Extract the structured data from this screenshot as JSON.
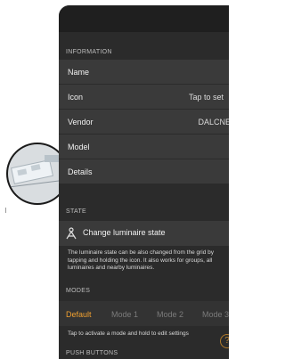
{
  "sections": {
    "information": "INFORMATION",
    "state": "STATE",
    "modes": "MODES",
    "push_buttons": "PUSH BUTTONS"
  },
  "info_rows": [
    {
      "label": "Name",
      "value": ""
    },
    {
      "label": "Icon",
      "value": "Tap to set"
    },
    {
      "label": "Vendor",
      "value": "DALCNE"
    },
    {
      "label": "Model",
      "value": ""
    },
    {
      "label": "Details",
      "value": ""
    }
  ],
  "state": {
    "button_label": "Change luminaire state",
    "note": "The luminaire state can be also changed from the grid by tapping and holding the icon. It also works for groups, all luminaires and nearby luminaires."
  },
  "modes": {
    "items": [
      "Default",
      "Mode 1",
      "Mode 2",
      "Mode 3"
    ],
    "active_index": 0,
    "hint": "Tap to activate a mode and hold to edit settings"
  },
  "colors": {
    "accent": "#f0a030",
    "background": "#2b2b2b",
    "row": "#3a3a3a"
  },
  "icons": {
    "state": "lamp-icon",
    "help": "help-circle-icon",
    "chevron": "chevron-right-icon"
  }
}
